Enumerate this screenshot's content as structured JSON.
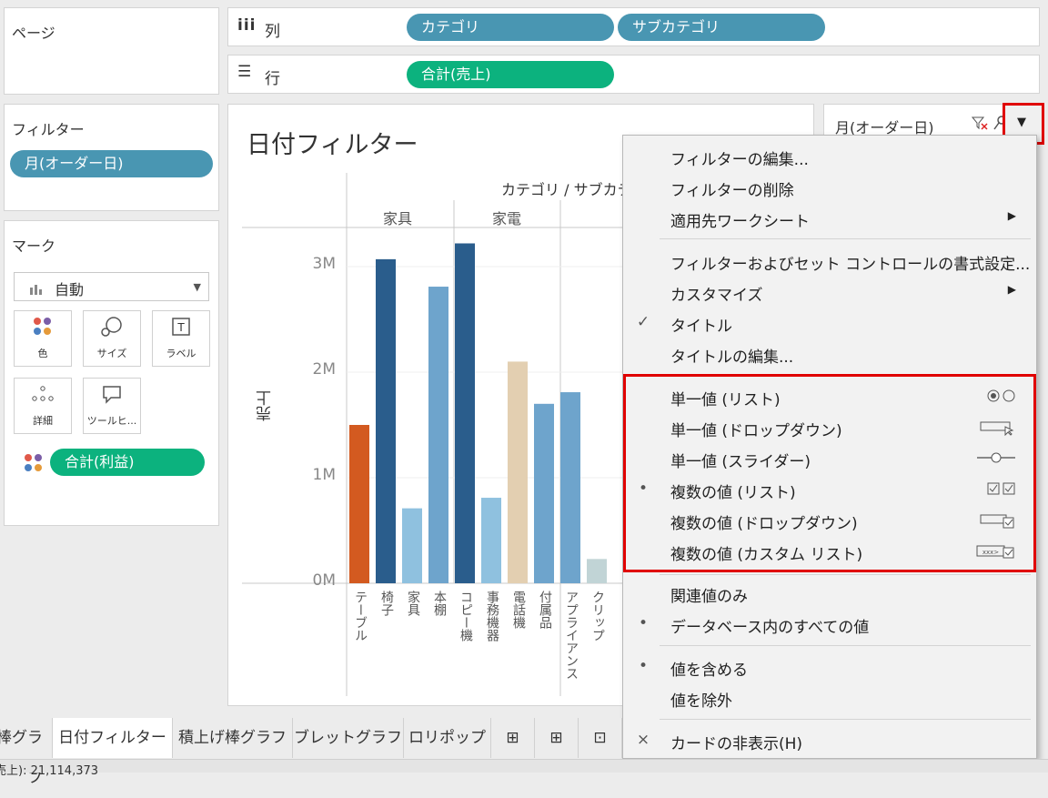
{
  "pages_card": {
    "title": "ページ"
  },
  "columns_shelf": {
    "label": "列",
    "pills": [
      "カテゴリ",
      "サブカテゴリ"
    ]
  },
  "rows_shelf": {
    "label": "行",
    "pills": [
      "合計(売上)"
    ]
  },
  "filters_card": {
    "title": "フィルター",
    "pills": [
      "月(オーダー日)"
    ]
  },
  "marks_card": {
    "title": "マーク",
    "type": "自動",
    "buttons": [
      "色",
      "サイズ",
      "ラベル",
      "詳細",
      "ツールヒ..."
    ],
    "pill": "合計(利益)"
  },
  "worksheet": {
    "title": "日付フィルター",
    "header_top": "カテゴリ / サブカテゴ",
    "category_headers": [
      "家具",
      "家電"
    ],
    "ylabel": "売上"
  },
  "chart_data": {
    "type": "bar",
    "ylabel": "売上",
    "ylim": [
      0,
      3300000
    ],
    "yticks": [
      "0M",
      "1M",
      "2M",
      "3M"
    ],
    "categories": [
      "テーブル",
      "椅子",
      "家具",
      "本棚",
      "コピー機",
      "事務機器",
      "電話機",
      "付属品",
      "アプライアンス",
      "クリップ"
    ],
    "values": [
      1500000,
      3070000,
      710000,
      2810000,
      3220000,
      810000,
      2100000,
      1700000,
      1810000,
      230000
    ],
    "colors": [
      "#d35a20",
      "#2a5d8c",
      "#8fc1df",
      "#6ea4cc",
      "#2a5d8c",
      "#8fc1df",
      "#e3cfb1",
      "#6ea4cc",
      "#6ea4cc",
      "#c1d4d6"
    ]
  },
  "filter_card": {
    "title": "月(オーダー日)"
  },
  "menu": {
    "items": [
      {
        "label": "フィルターの編集...",
        "mark": "",
        "arrow": false
      },
      {
        "label": "フィルターの削除",
        "mark": "",
        "arrow": false
      },
      {
        "label": "適用先ワークシート",
        "mark": "",
        "arrow": true
      },
      {
        "label": "フィルターおよびセット コントロールの書式設定...",
        "mark": "",
        "arrow": false
      },
      {
        "label": "カスタマイズ",
        "mark": "",
        "arrow": true
      },
      {
        "label": "タイトル",
        "mark": "✓",
        "arrow": false
      },
      {
        "label": "タイトルの編集...",
        "mark": "",
        "arrow": false
      },
      {
        "label": "単一値 (リスト)",
        "mark": "",
        "icon": "radio-list-icon"
      },
      {
        "label": "単一値 (ドロップダウン)",
        "mark": "",
        "icon": "dropdown-icon"
      },
      {
        "label": "単一値 (スライダー)",
        "mark": "",
        "icon": "slider-icon"
      },
      {
        "label": "複数の値 (リスト)",
        "mark": "•",
        "icon": "checkbox-list-icon"
      },
      {
        "label": "複数の値 (ドロップダウン)",
        "mark": "",
        "icon": "multi-dropdown-icon"
      },
      {
        "label": "複数の値 (カスタム リスト)",
        "mark": "",
        "icon": "custom-list-icon"
      },
      {
        "label": "関連値のみ",
        "mark": ""
      },
      {
        "label": "データベース内のすべての値",
        "mark": "•"
      },
      {
        "label": "値を含める",
        "mark": "•"
      },
      {
        "label": "値を除外",
        "mark": ""
      },
      {
        "label": "カードの非表示(H)",
        "mark": "×"
      }
    ]
  },
  "tabs": [
    "棒グラフ",
    "日付フィルター",
    "積上げ棒グラフ",
    "ブレットグラフ",
    "ロリポップ"
  ],
  "status": {
    "text": "売上): 21,114,373"
  },
  "colors": {
    "blue_pill": "#4996b2",
    "green_pill": "#0cb27e",
    "highlight": "#e00000"
  }
}
